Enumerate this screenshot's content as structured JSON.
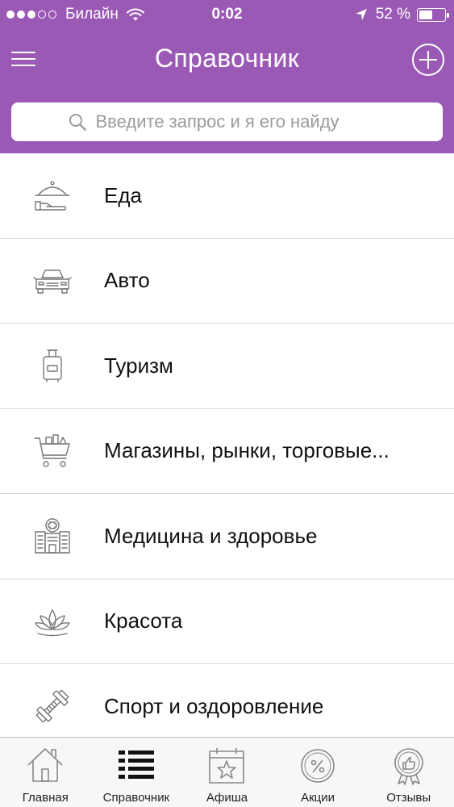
{
  "status_bar": {
    "carrier": "Билайн",
    "time": "0:02",
    "battery_percent": "52 %",
    "battery_level": 0.52,
    "signal_bars_filled": 3,
    "signal_bars_total": 5
  },
  "header": {
    "title": "Справочник",
    "background_color": "#9b59b6"
  },
  "search": {
    "placeholder": "Введите запрос и я его найду",
    "value": ""
  },
  "categories": [
    {
      "label": "Еда",
      "icon": "food-cloche-icon"
    },
    {
      "label": "Авто",
      "icon": "car-icon"
    },
    {
      "label": "Туризм",
      "icon": "suitcase-icon"
    },
    {
      "label": "Магазины, рынки, торговые...",
      "icon": "shopping-cart-icon"
    },
    {
      "label": "Медицина и здоровье",
      "icon": "hospital-icon"
    },
    {
      "label": "Красота",
      "icon": "lotus-icon"
    },
    {
      "label": "Спорт и оздоровление",
      "icon": "dumbbell-icon"
    }
  ],
  "tab_bar": {
    "active_tab": "Справочник",
    "tabs": [
      {
        "label": "Главная",
        "icon": "home-icon"
      },
      {
        "label": "Справочник",
        "icon": "list-icon"
      },
      {
        "label": "Афиша",
        "icon": "calendar-star-icon"
      },
      {
        "label": "Акции",
        "icon": "discount-icon"
      },
      {
        "label": "Отзывы",
        "icon": "thumbs-up-badge-icon"
      }
    ]
  }
}
